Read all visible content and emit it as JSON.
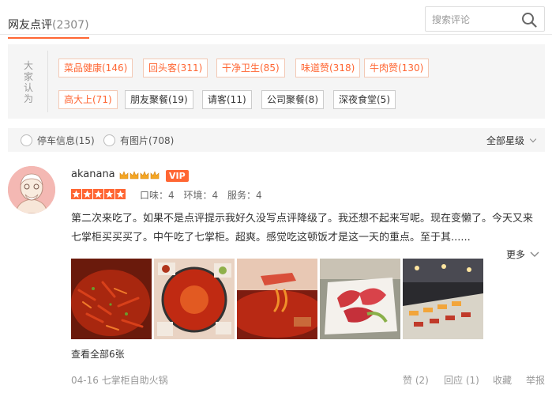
{
  "header": {
    "tab_label": "网友点评",
    "tab_count": "(2307)"
  },
  "search": {
    "placeholder": "搜索评论",
    "icon": "search-icon"
  },
  "tags": {
    "label_chars": [
      "大",
      "家",
      "认",
      "为"
    ],
    "rows": [
      [
        {
          "text": "菜品健康(146)",
          "hot": true
        },
        {
          "text": "回头客(311)",
          "hot": true
        },
        {
          "text": "干净卫生(85)",
          "hot": true
        },
        {
          "text": "味道赞(318)",
          "hot": true
        },
        {
          "text": "牛肉赞(130)",
          "hot": true
        }
      ],
      [
        {
          "text": "高大上(71)",
          "hot": true
        },
        {
          "text": "朋友聚餐(19)",
          "hot": false
        },
        {
          "text": "请客(11)",
          "hot": false
        },
        {
          "text": "公司聚餐(8)",
          "hot": false
        },
        {
          "text": "深夜食堂(5)",
          "hot": false
        }
      ]
    ]
  },
  "filters": {
    "parking": "停车信息(15)",
    "with_photos": "有图片(708)",
    "star_filter": "全部星级"
  },
  "review": {
    "username": "akanana",
    "vip": "VIP",
    "crown_count": 4,
    "rating_stars": 5,
    "scores": [
      "口味：4",
      "环境：4",
      "服务：4"
    ],
    "text": "第二次来吃了。如果不是点评提示我好久没写点评降级了。我还想不起来写呢。现在变懒了。今天又来七掌柜买买买了。中午吃了七掌柜。超爽。感觉吃这顿饭才是这一天的重点。至于其......",
    "more": "更多",
    "view_all_photos": "查看全部6张",
    "date_shop": "04-16  七掌柜自助火锅",
    "actions": {
      "like": "赞 (2)",
      "reply": "回应 (1)",
      "favorite": "收藏",
      "report": "举报"
    }
  },
  "colors": {
    "accent": "#ff6633",
    "panel_bg": "#f5f5f5"
  }
}
